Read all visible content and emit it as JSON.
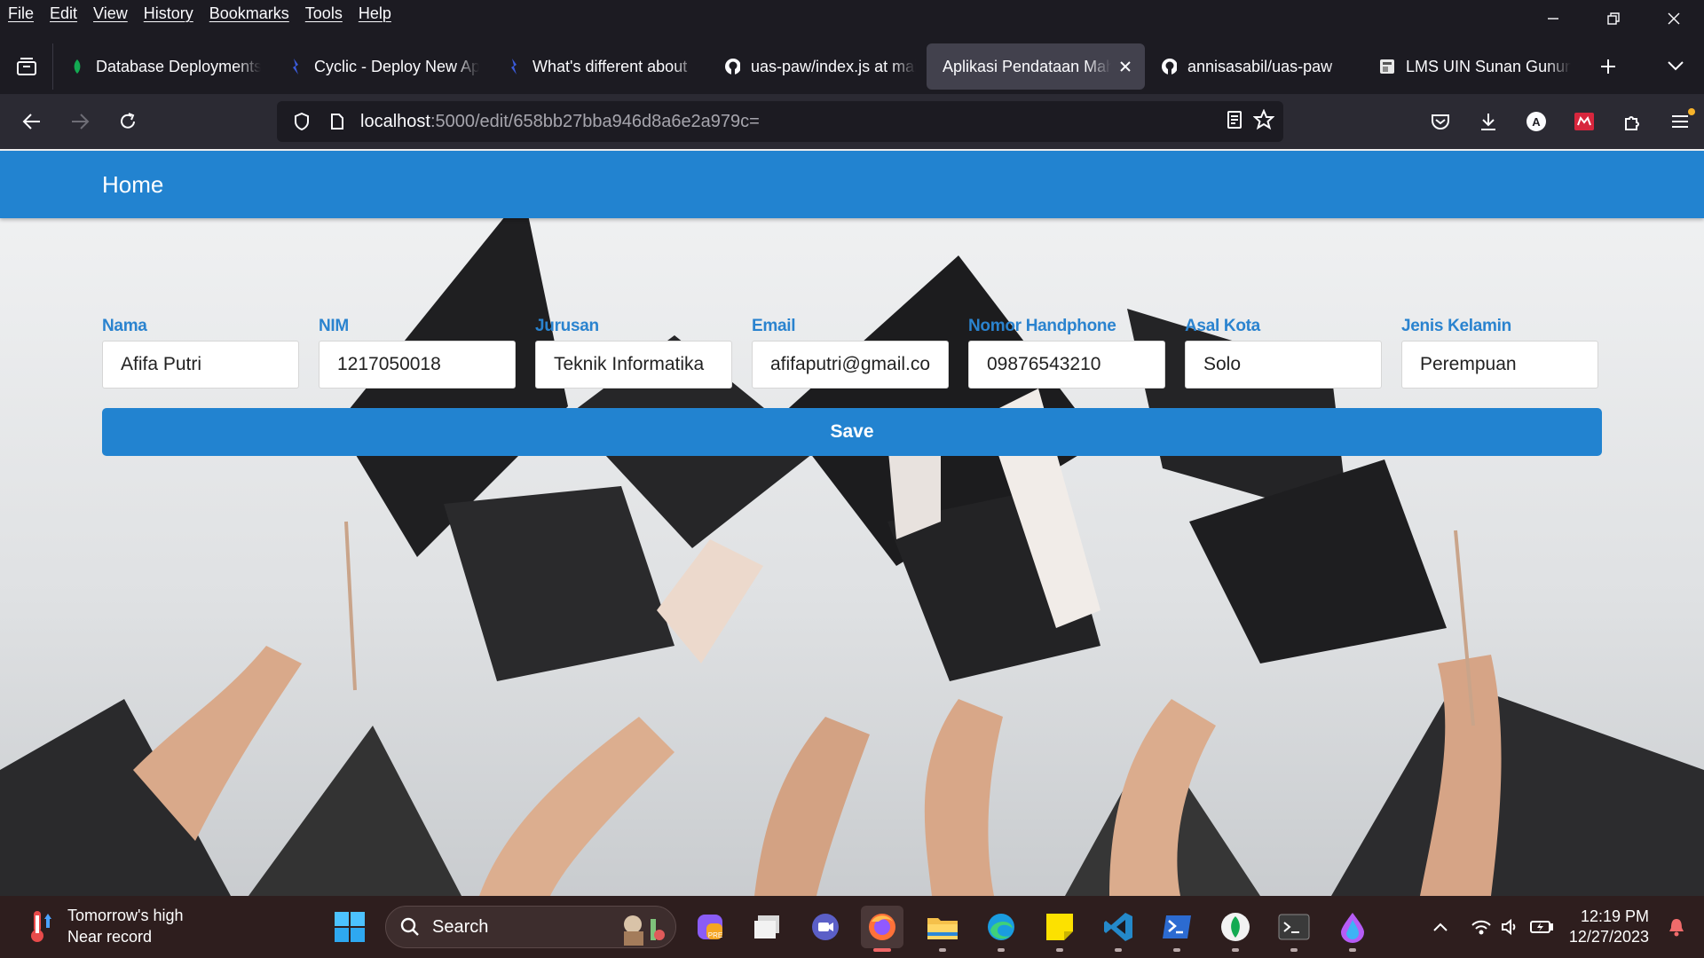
{
  "menubar": {
    "items": [
      "File",
      "Edit",
      "View",
      "History",
      "Bookmarks",
      "Tools",
      "Help"
    ]
  },
  "tabs": [
    {
      "title": "Database Deployments",
      "icon": "mongodb-leaf-icon",
      "active": false
    },
    {
      "title": "Cyclic - Deploy New App",
      "icon": "cyclic-icon",
      "active": false
    },
    {
      "title": "What's different about",
      "icon": "cyclic-icon",
      "active": false
    },
    {
      "title": "uas-paw/index.js at main",
      "icon": "github-icon",
      "active": false
    },
    {
      "title": "Aplikasi Pendataan Mahasiswa",
      "icon": "page-icon",
      "active": true
    },
    {
      "title": "annisasabil/uas-paw",
      "icon": "github-icon",
      "active": false
    },
    {
      "title": "LMS UIN Sunan Gunung Djati",
      "icon": "lms-icon",
      "active": false
    }
  ],
  "urlbar": {
    "host": "localhost",
    "path": ":5000/edit/658bb27bba946d8a6e2a979c="
  },
  "app": {
    "nav": {
      "home_label": "Home"
    },
    "form": {
      "fields": [
        {
          "label": "Nama",
          "value": "Afifa Putri"
        },
        {
          "label": "NIM",
          "value": "1217050018"
        },
        {
          "label": "Jurusan",
          "value": "Teknik Informatika"
        },
        {
          "label": "Email",
          "value": "afifaputri@gmail.com"
        },
        {
          "label": "Nomor Handphone",
          "value": "09876543210"
        },
        {
          "label": "Asal Kota",
          "value": "Solo"
        },
        {
          "label": "Jenis Kelamin",
          "value": "Perempuan"
        }
      ],
      "save_label": "Save"
    }
  },
  "taskbar": {
    "weather": {
      "line1": "Tomorrow's high",
      "line2": "Near record"
    },
    "search_label": "Search",
    "clock": {
      "time": "12:19 PM",
      "date": "12/27/2023"
    }
  },
  "colors": {
    "accent": "#2283d0",
    "label": "#2a83cf",
    "browser_bg": "#1c1b22",
    "toolbar_bg": "#2b2a33",
    "taskbar_bg": "#2e1e1e"
  }
}
